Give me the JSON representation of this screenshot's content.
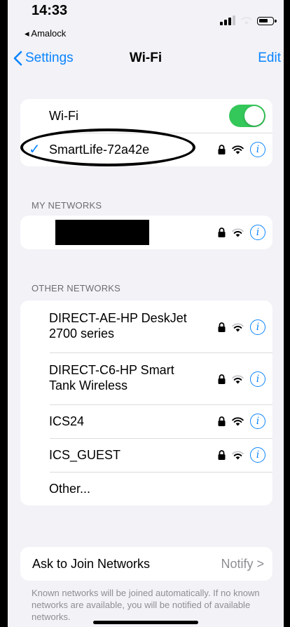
{
  "status_bar": {
    "time": "14:33",
    "back_app": "◂ Amalock"
  },
  "nav": {
    "back_label": "Settings",
    "title": "Wi-Fi",
    "edit_label": "Edit"
  },
  "wifi_toggle": {
    "label": "Wi-Fi",
    "on": true
  },
  "connected_network": {
    "name": "SmartLife-72a42e",
    "secured": true,
    "checked": true
  },
  "my_networks": {
    "header": "MY NETWORKS",
    "items": [
      {
        "name": "",
        "redacted": true,
        "secured": true
      }
    ]
  },
  "other_networks": {
    "header": "OTHER NETWORKS",
    "items": [
      {
        "name": "DIRECT-AE-HP DeskJet 2700 series",
        "secured": true
      },
      {
        "name": "DIRECT-C6-HP Smart Tank Wireless",
        "secured": true
      },
      {
        "name": "ICS24",
        "secured": true
      },
      {
        "name": "ICS_GUEST",
        "secured": true
      },
      {
        "name": "Other..."
      }
    ]
  },
  "ask_to_join": {
    "label": "Ask to Join Networks",
    "value": "Notify >"
  },
  "footnote": "Known networks will be joined automatically. If no known networks are available, you will be notified of available networks.",
  "colors": {
    "accent": "#0a84ff",
    "toggle_on": "#34c759",
    "background": "#f2f2f7"
  }
}
